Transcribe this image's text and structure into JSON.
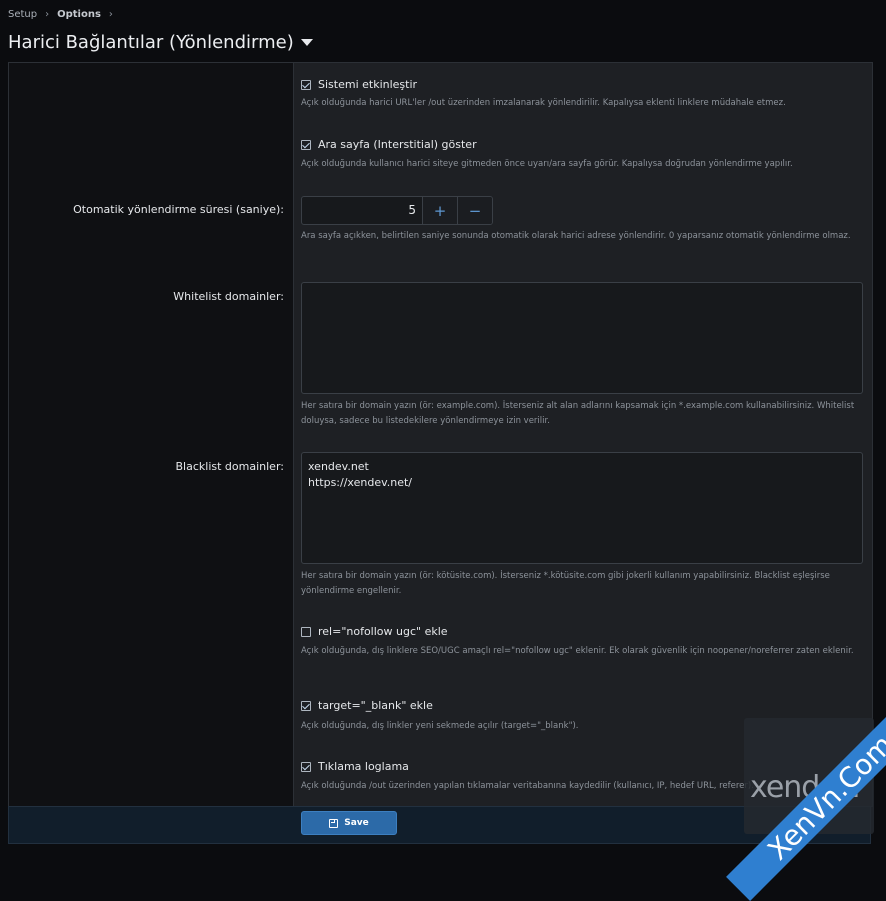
{
  "breadcrumb": {
    "items": [
      "Setup",
      "Options"
    ]
  },
  "page": {
    "title": "Harici Bağlantılar (Yönlendirme)"
  },
  "options": {
    "enable": {
      "label": "Sistemi etkinleştir",
      "checked": true,
      "hint": "Açık olduğunda harici URL'ler /out üzerinden imzalanarak yönlendirilir. Kapalıysa eklenti linklere müdahale etmez."
    },
    "interstitial": {
      "label": "Ara sayfa (Interstitial) göster",
      "checked": true,
      "hint": "Açık olduğunda kullanıcı harici siteye gitmeden önce uyarı/ara sayfa görür. Kapalıysa doğrudan yönlendirme yapılır."
    },
    "redirect_delay": {
      "label": "Otomatik yönlendirme süresi (saniye):",
      "value": "5",
      "plus": "+",
      "minus": "−",
      "hint": "Ara sayfa açıkken, belirtilen saniye sonunda otomatik olarak harici adrese yönlendirir. 0 yaparsanız otomatik yönlendirme olmaz."
    },
    "whitelist": {
      "label": "Whitelist domainler:",
      "value": "",
      "hint": "Her satıra bir domain yazın (ör: example.com). İsterseniz alt alan adlarını kapsamak için *.example.com kullanabilirsiniz. Whitelist doluysa, sadece bu listedekilere yönlendirmeye izin verilir."
    },
    "blacklist": {
      "label": "Blacklist domainler:",
      "value": "xendev.net\nhttps://xendev.net/",
      "hint": "Her satıra bir domain yazın (ör: kötüsite.com). İsterseniz *.kötüsite.com gibi jokerli kullanım yapabilirsiniz. Blacklist eşleşirse yönlendirme engellenir."
    },
    "nofollow": {
      "label": "rel=\"nofollow ugc\" ekle",
      "checked": false,
      "hint": "Açık olduğunda, dış linklere SEO/UGC amaçlı rel=\"nofollow ugc\" eklenir. Ek olarak güvenlik için noopener/noreferrer zaten eklenir."
    },
    "target_blank": {
      "label": "target=\"_blank\" ekle",
      "checked": true,
      "hint": "Açık olduğunda, dış linkler yeni sekmede açılır (target=\"_blank\")."
    },
    "click_log": {
      "label": "Tıklama loglama",
      "checked": true,
      "hint": "Açık olduğunda /out üzerinden yapılan tıklamalar veritabanına kaydedilir (kullanıcı, IP, hedef URL, referer)."
    }
  },
  "footer": {
    "save_label": "Save"
  },
  "watermark": {
    "box_text": "xendev.",
    "band_text": "XenVn.Com"
  },
  "colors": {
    "accent": "#2c6aa8",
    "panel": "#1e2024",
    "background": "#0b0c0f"
  }
}
